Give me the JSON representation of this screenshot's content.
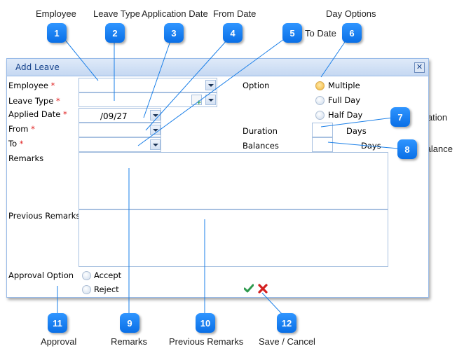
{
  "callouts": [
    {
      "num": "1",
      "caption": "Employee"
    },
    {
      "num": "2",
      "caption": "Leave Type"
    },
    {
      "num": "3",
      "caption": "Application Date"
    },
    {
      "num": "4",
      "caption": "From Date"
    },
    {
      "num": "5",
      "caption": "To Date"
    },
    {
      "num": "6",
      "caption": "Day Options"
    },
    {
      "num": "7",
      "caption": "Duration"
    },
    {
      "num": "8",
      "caption": "Balance"
    },
    {
      "num": "9",
      "caption": "Remarks"
    },
    {
      "num": "10",
      "caption": "Previous Remarks"
    },
    {
      "num": "11",
      "caption": "Approval"
    },
    {
      "num": "12",
      "caption": "Save / Cancel"
    }
  ],
  "dialog": {
    "title": "Add Leave",
    "close_icon": "close-icon",
    "required_marker": "*",
    "fields": {
      "employee": {
        "label": "Employee",
        "value": ""
      },
      "leave_type": {
        "label": "Leave Type",
        "value": ""
      },
      "applied_date": {
        "label": "Applied Date",
        "value": "/09/27"
      },
      "from": {
        "label": "From",
        "value": ""
      },
      "to": {
        "label": "To",
        "value": ""
      },
      "remarks": {
        "label": "Remarks",
        "value": ""
      },
      "previous_remarks": {
        "label": "Previous Remarks",
        "value": ""
      }
    },
    "option": {
      "label": "Option",
      "choices": [
        "Multiple",
        "Full Day",
        "Half Day"
      ],
      "selected": "Multiple"
    },
    "duration": {
      "label": "Duration",
      "value": "",
      "unit": "Days"
    },
    "balances": {
      "label": "Balances",
      "value": "",
      "unit": "Days"
    },
    "approval": {
      "label": "Approval Option",
      "choices": [
        "Accept",
        "Reject"
      ],
      "selected": ""
    },
    "actions": {
      "save_icon": "check-icon",
      "cancel_icon": "x-icon"
    }
  }
}
